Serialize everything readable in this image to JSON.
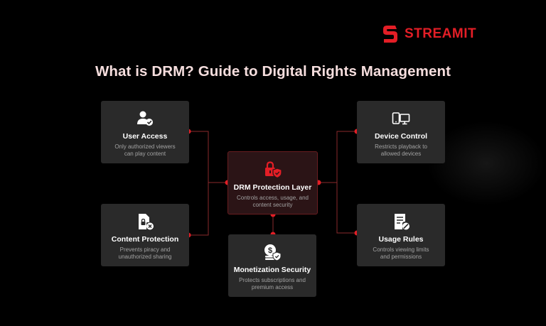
{
  "brand": {
    "name": "STREAMIT"
  },
  "title": "What is DRM? Guide to Digital Rights Management",
  "colors": {
    "accent": "#e31e26",
    "card": "#2a2a2a",
    "center_card": "#2b1416",
    "background": "#000000"
  },
  "center": {
    "icon": "padlock-shield-icon",
    "heading": "DRM Protection Layer",
    "desc": [
      "Controls access, usage, and",
      "content security"
    ]
  },
  "nodes": {
    "user_access": {
      "icon": "user-check-icon",
      "heading": "User Access",
      "desc": [
        "Only authorized viewers",
        "can play content"
      ]
    },
    "content_protection": {
      "icon": "locked-file-icon",
      "heading": "Content Protection",
      "desc": [
        "Prevents piracy and",
        "unauthorized sharing"
      ]
    },
    "device_control": {
      "icon": "devices-icon",
      "heading": "Device Control",
      "desc": [
        "Restricts playback to",
        "allowed devices"
      ]
    },
    "usage_rules": {
      "icon": "document-rules-icon",
      "heading": "Usage Rules",
      "desc": [
        "Controls viewing limits",
        "and permissions"
      ]
    },
    "monetization_security": {
      "icon": "coins-shield-icon",
      "heading": "Monetization Security",
      "desc": [
        "Protects subscriptions and",
        "premium access"
      ]
    }
  }
}
